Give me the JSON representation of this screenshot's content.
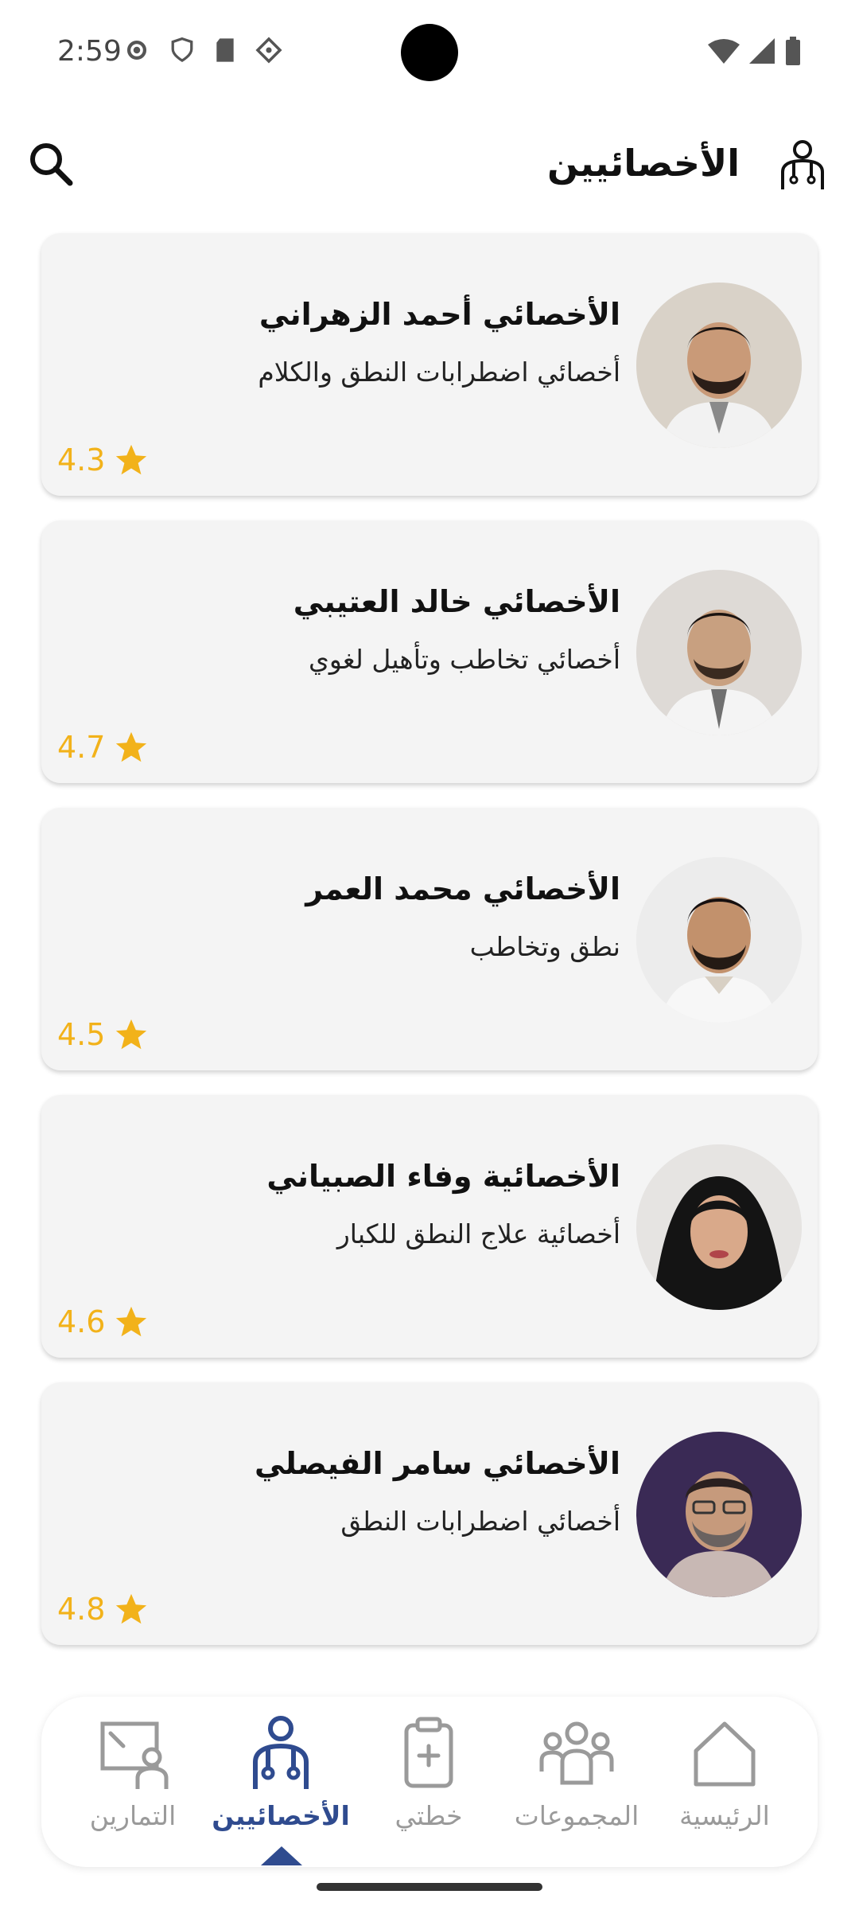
{
  "status_bar": {
    "time": "2:59"
  },
  "app_bar": {
    "title": "الأخصائيين"
  },
  "specialists": [
    {
      "name": "الأخصائي أحمد الزهراني",
      "specialty": "أخصائي اضطرابات النطق والكلام",
      "rating": "4.3",
      "avatar": "male-doctor-avatar"
    },
    {
      "name": "الأخصائي خالد العتيبي",
      "specialty": "أخصائي تخاطب وتأهيل لغوي",
      "rating": "4.7",
      "avatar": "male-doctor-avatar"
    },
    {
      "name": "الأخصائي محمد العمر",
      "specialty": "نطق وتخاطب",
      "rating": "4.5",
      "avatar": "male-doctor-avatar"
    },
    {
      "name": "الأخصائية وفاء الصبياني",
      "specialty": "أخصائية علاج النطق للكبار",
      "rating": "4.6",
      "avatar": "female-doctor-avatar"
    },
    {
      "name": "الأخصائي سامر الفيصلي",
      "specialty": "أخصائي اضطرابات النطق",
      "rating": "4.8",
      "avatar": "male-doctor-avatar"
    }
  ],
  "bottom_nav": {
    "items": [
      {
        "label": "التمارين",
        "icon": "exercise-board-icon",
        "active": false
      },
      {
        "label": "الأخصائيين",
        "icon": "specialist-icon",
        "active": true
      },
      {
        "label": "خطتي",
        "icon": "clipboard-plus-icon",
        "active": false
      },
      {
        "label": "المجموعات",
        "icon": "groups-icon",
        "active": false
      },
      {
        "label": "الرئيسية",
        "icon": "home-icon",
        "active": false
      }
    ]
  },
  "colors": {
    "accent": "#2f4b8f",
    "rating": "#f2b21a",
    "card_bg": "#f4f4f4",
    "inactive": "#9a9a9a"
  }
}
